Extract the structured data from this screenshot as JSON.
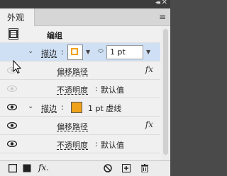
{
  "panel": {
    "tab_label": "外观",
    "menu_icon": "hamburger-menu-icon"
  },
  "topbar": {
    "collapse_label": "◂◂",
    "close_label": "✕"
  },
  "rows": {
    "group_label": "编组",
    "stroke1_label": "描边",
    "stroke1_colon": ":",
    "stroke1_width": "1 pt",
    "offset1_label": "偏移路径",
    "opacity1_label": "不透明度",
    "opacity1_value": "默认值",
    "stroke2_label": "描边",
    "stroke2_colon": ":",
    "stroke2_value": "1 pt 虚线",
    "offset2_label": "偏移路径",
    "opacity2_label": "不透明度",
    "opacity2_value": "默认值",
    "fx_label": "fx"
  },
  "colors": {
    "accent": "#f0a21a",
    "selection": "#cfe0f5"
  },
  "bottombar": {
    "fx_label": "fx.",
    "icons": [
      "new-stroke-icon",
      "new-fill-icon",
      "add-effect-icon",
      "clear-appearance-icon",
      "duplicate-item-icon",
      "delete-item-icon"
    ]
  }
}
